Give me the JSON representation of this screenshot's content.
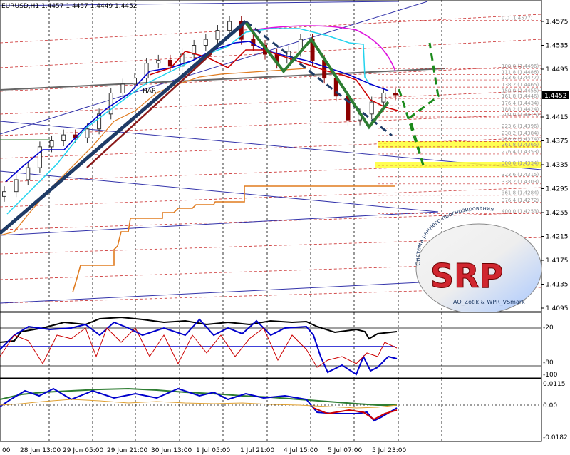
{
  "header": {
    "symbol_line": "EURUSD,H1  1.4457 1.4457 1.4449 1.4452"
  },
  "current_price_label": "1.4452",
  "price_overlay_text": "HAR",
  "logo": {
    "text": "SRP",
    "arc_text": "Система раннего прогнозирования",
    "footer_text": "AO_Zotik & WPR_VSmark"
  },
  "colors": {
    "candles_bull": "#333333",
    "candles_bear": "#8b0000",
    "ma_blue": "#0000cc",
    "ma_red": "#cc0000",
    "ma_cyan": "#22d3ee",
    "ma_orange": "#e07b1f",
    "ma_magenta": "#dd11dd",
    "trend_navy": "#1f3b66",
    "zigzag_green": "#2e7d32",
    "forecast_dash": "#1b8a1b",
    "fibo_red": "#cc3333",
    "fibo_zone_yellow": "#ffff33"
  },
  "chart_data": [
    {
      "type": "line",
      "title": "",
      "y_axis_ticks": [
        "1.4575",
        "1.4535",
        "1.4495",
        "1.4455",
        "1.4415",
        "1.4375",
        "1.4335",
        "1.4295",
        "1.4255",
        "1.4215",
        "1.4175",
        "1.4135",
        "1.4095"
      ],
      "ylim": [
        1.4075,
        1.46
      ],
      "x_axis_ticks": [
        ":00",
        "28 Jun 13:00",
        "29 Jun 05:00",
        "29 Jun 21:00",
        "30 Jun 13:00",
        "1 Jul 05:00",
        "1 Jul 21:00",
        "4 Jul 15:00",
        "5 Jul 07:00",
        "5 Jul 23:00"
      ],
      "price_close_approx": [
        1.429,
        1.431,
        1.433,
        1.4365,
        1.4375,
        1.4385,
        1.438,
        1.4395,
        1.442,
        1.4455,
        1.447,
        1.448,
        1.4505,
        1.451,
        1.45,
        1.452,
        1.4535,
        1.4545,
        1.456,
        1.4575,
        1.4545,
        1.4535,
        1.452,
        1.4505,
        1.4525,
        1.4545,
        1.451,
        1.448,
        1.445,
        1.441,
        1.442,
        1.444,
        1.4455,
        1.4452
      ],
      "zigzag_points": [
        [
          1.424,
          1.4575
        ],
        [
          1.4575,
          1.4505
        ],
        [
          1.4505,
          1.4545
        ],
        [
          1.4545,
          1.44
        ],
        [
          1.44,
          1.4458
        ]
      ],
      "forecast_points": [
        1.4458,
        1.4335,
        1.438,
        1.451
      ],
      "fibo_levels": [
        {
          "label": "0.0 (1.4577)",
          "price": 1.4577
        },
        {
          "label": "100.0 (1.4496)",
          "price": 1.4496
        },
        {
          "label": "111.8 (1.4486)",
          "price": 1.4486
        },
        {
          "label": "123.6 (1.4477)",
          "price": 1.4477
        },
        {
          "label": "138.2 (1.4465)",
          "price": 1.4465
        },
        {
          "label": "150.0 (1.4455)",
          "price": 1.4455
        },
        {
          "label": "161.8 (1.4446)",
          "price": 1.4446
        },
        {
          "label": "176.4 (1.4434)",
          "price": 1.4434
        },
        {
          "label": "188.2 (1.4424)",
          "price": 1.4424
        },
        {
          "label": "200.0 (1.4415)",
          "price": 1.4415
        },
        {
          "label": "223.6 (1.4396)",
          "price": 1.4396
        },
        {
          "label": "238.2 (1.4384)",
          "price": 1.4384
        },
        {
          "label": "250.0 (1.4374)",
          "price": 1.4374
        },
        {
          "label": "261.8 (1.4365)",
          "price": 1.4365
        },
        {
          "label": "276.4 (1.4353)",
          "price": 1.4353
        },
        {
          "label": "300.0 (1.4334)",
          "price": 1.4334
        },
        {
          "label": "323.6 (1.4315)",
          "price": 1.4315
        },
        {
          "label": "338.2 (1.4303)",
          "price": 1.4303
        },
        {
          "label": "361.8 (1.4284)",
          "price": 1.4284
        },
        {
          "label": "376.4 (1.4272)",
          "price": 1.4272
        },
        {
          "label": "400.0 (1.4253)",
          "price": 1.4253
        }
      ],
      "highlight_zones": [
        [
          1.437,
          1.4378
        ],
        [
          1.4338,
          1.4346
        ]
      ]
    },
    {
      "type": "line",
      "title": "",
      "y_axis_ticks": [
        "-20",
        "-80",
        "-100"
      ],
      "ylim": [
        -100,
        0
      ]
    },
    {
      "type": "line",
      "title": "",
      "y_axis_ticks": [
        "0.0115",
        "0.00",
        "-0.0182"
      ],
      "ylim": [
        -0.0182,
        0.0115
      ]
    }
  ]
}
